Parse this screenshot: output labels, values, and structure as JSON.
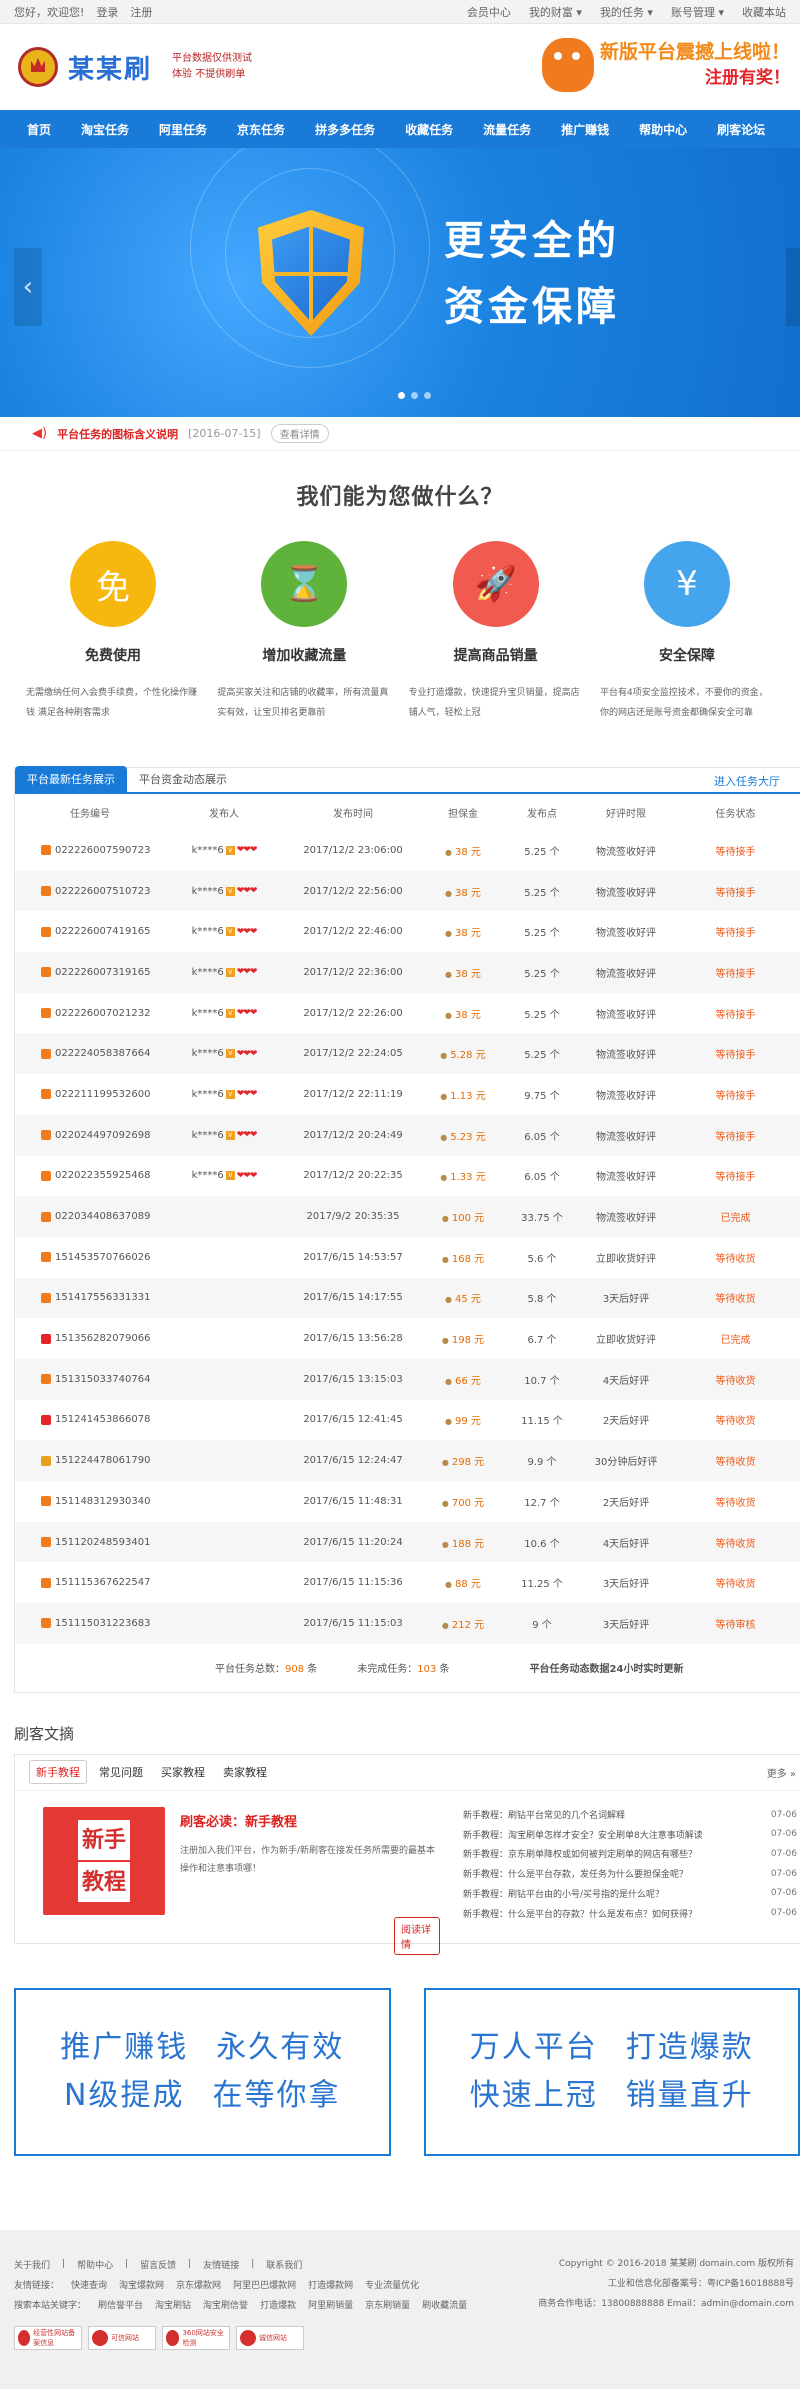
{
  "topbar": {
    "greeting": "您好，欢迎您!",
    "login": "登录",
    "register": "注册",
    "links": [
      "会员中心",
      "我的财富 ▾",
      "我的任务 ▾",
      "账号管理 ▾",
      "收藏本站"
    ]
  },
  "header": {
    "site_name": "某某刷",
    "tag_line1": "平台数据仅供测试",
    "tag_line2": "体验   不提供刷单",
    "promo_line1": "新版平台震撼上线啦！",
    "promo_line2": "注册有奖！"
  },
  "nav": [
    "首页",
    "淘宝任务",
    "阿里任务",
    "京东任务",
    "拼多多任务",
    "收藏任务",
    "流量任务",
    "推广赚钱",
    "帮助中心",
    "刷客论坛"
  ],
  "hero": {
    "line1": "更安全的",
    "line2": "资金保障",
    "prev": "‹",
    "next": "›"
  },
  "notice": {
    "text": "平台任务的图标含义说明",
    "date": "[2016-07-15]",
    "more": "查看详情"
  },
  "features": {
    "title": "我们能为您做什么？",
    "items": [
      {
        "icon": "免",
        "name": "免费使用",
        "desc": "无需缴纳任何入会费手续费，个性化操作赚钱 满足各种刷客需求",
        "color": "#f6b80e"
      },
      {
        "icon": "⌛",
        "name": "增加收藏流量",
        "desc": "提高买家关注和店铺的收藏率，所有流量真实有效，让宝贝排名更靠前",
        "color": "#5fb33a"
      },
      {
        "icon": "🚀",
        "name": "提高商品销量",
        "desc": "专业打造爆款，快速提升宝贝销量，提高店铺人气，轻松上冠",
        "color": "#f05a4f"
      },
      {
        "icon": "¥",
        "name": "安全保障",
        "desc": "平台有4项安全监控技术，不要你的资金，你的网店还是账号资金都确保安全可靠",
        "color": "#45a5ec"
      }
    ]
  },
  "tasks": {
    "tab_active": "平台最新任务展示",
    "tab_other": "平台资金动态展示",
    "enter": "进入任务大厅",
    "headers": [
      "任务编号",
      "发布人",
      "发布时间",
      "担保金",
      "发布点",
      "好评时限",
      "任务状态"
    ],
    "rows": [
      {
        "p": "tb",
        "id": "022226007590723",
        "pub": "k****6",
        "time": "2017/12/2 23:06:00",
        "dep": "38 元",
        "pts": "5.25 个",
        "limit": "物流签收好评",
        "status": "等待接手"
      },
      {
        "p": "tb",
        "id": "022226007510723",
        "pub": "k****6",
        "time": "2017/12/2 22:56:00",
        "dep": "38 元",
        "pts": "5.25 个",
        "limit": "物流签收好评",
        "status": "等待接手"
      },
      {
        "p": "tb",
        "id": "022226007419165",
        "pub": "k****6",
        "time": "2017/12/2 22:46:00",
        "dep": "38 元",
        "pts": "5.25 个",
        "limit": "物流签收好评",
        "status": "等待接手"
      },
      {
        "p": "tb",
        "id": "022226007319165",
        "pub": "k****6",
        "time": "2017/12/2 22:36:00",
        "dep": "38 元",
        "pts": "5.25 个",
        "limit": "物流签收好评",
        "status": "等待接手"
      },
      {
        "p": "tb",
        "id": "022226007021232",
        "pub": "k****6",
        "time": "2017/12/2 22:26:00",
        "dep": "38 元",
        "pts": "5.25 个",
        "limit": "物流签收好评",
        "status": "等待接手"
      },
      {
        "p": "tb",
        "id": "022224058387664",
        "pub": "k****6",
        "time": "2017/12/2 22:24:05",
        "dep": "5.28 元",
        "pts": "5.25 个",
        "limit": "物流签收好评",
        "status": "等待接手"
      },
      {
        "p": "tb",
        "id": "022211199532600",
        "pub": "k****6",
        "time": "2017/12/2 22:11:19",
        "dep": "1.13 元",
        "pts": "9.75 个",
        "limit": "物流签收好评",
        "status": "等待接手"
      },
      {
        "p": "tb",
        "id": "022024497092698",
        "pub": "k****6",
        "time": "2017/12/2 20:24:49",
        "dep": "5.23 元",
        "pts": "6.05 个",
        "limit": "物流签收好评",
        "status": "等待接手"
      },
      {
        "p": "tb",
        "id": "022022355925468",
        "pub": "k****6",
        "time": "2017/12/2 20:22:35",
        "dep": "1.33 元",
        "pts": "6.05 个",
        "limit": "物流签收好评",
        "status": "等待接手"
      },
      {
        "p": "tb",
        "id": "022034408637089",
        "pub": "",
        "time": "2017/9/2 20:35:35",
        "dep": "100 元",
        "pts": "33.75 个",
        "limit": "物流签收好评",
        "status": "已完成"
      },
      {
        "p": "tb",
        "id": "151453570766026",
        "pub": "",
        "time": "2017/6/15 14:53:57",
        "dep": "168 元",
        "pts": "5.6 个",
        "limit": "立即收货好评",
        "status": "等待收货"
      },
      {
        "p": "tb",
        "id": "151417556331331",
        "pub": "",
        "time": "2017/6/15 14:17:55",
        "dep": "45 元",
        "pts": "5.8 个",
        "limit": "3天后好评",
        "status": "等待收货"
      },
      {
        "p": "jd",
        "id": "151356282079066",
        "pub": "",
        "time": "2017/6/15 13:56:28",
        "dep": "198 元",
        "pts": "6.7 个",
        "limit": "立即收货好评",
        "status": "已完成"
      },
      {
        "p": "tb",
        "id": "151315033740764",
        "pub": "",
        "time": "2017/6/15 13:15:03",
        "dep": "66 元",
        "pts": "10.7 个",
        "limit": "4天后好评",
        "status": "等待收货"
      },
      {
        "p": "jd",
        "id": "151241453866078",
        "pub": "",
        "time": "2017/6/15 12:41:45",
        "dep": "99 元",
        "pts": "11.15 个",
        "limit": "2天后好评",
        "status": "等待收货"
      },
      {
        "p": "gold",
        "id": "151224478061790",
        "pub": "",
        "time": "2017/6/15 12:24:47",
        "dep": "298 元",
        "pts": "9.9 个",
        "limit": "30分钟后好评",
        "status": "等待收货"
      },
      {
        "p": "tb",
        "id": "151148312930340",
        "pub": "",
        "time": "2017/6/15 11:48:31",
        "dep": "700 元",
        "pts": "12.7 个",
        "limit": "2天后好评",
        "status": "等待收货"
      },
      {
        "p": "tb",
        "id": "151120248593401",
        "pub": "",
        "time": "2017/6/15 11:20:24",
        "dep": "188 元",
        "pts": "10.6 个",
        "limit": "4天后好评",
        "status": "等待收货"
      },
      {
        "p": "tb",
        "id": "151115367622547",
        "pub": "",
        "time": "2017/6/15 11:15:36",
        "dep": "88 元",
        "pts": "11.25 个",
        "limit": "3天后好评",
        "status": "等待收货"
      },
      {
        "p": "tb",
        "id": "151115031223683",
        "pub": "",
        "time": "2017/6/15 11:15:03",
        "dep": "212 元",
        "pts": "9 个",
        "limit": "3天后好评",
        "status": "等待审核"
      }
    ],
    "summary_total_label": "平台任务总数：",
    "summary_total": "908",
    "summary_total_unit": " 条",
    "summary_unfinished_label": "未完成任务：",
    "summary_unfinished": "103",
    "summary_unfinished_unit": " 条",
    "summary_note": "平台任务动态数据24小时实时更新"
  },
  "articles": {
    "heading": "刷客文摘",
    "tabs": [
      "新手教程",
      "常见问题",
      "买家教程",
      "卖家教程"
    ],
    "more": "更多 »",
    "feature_line1": "新手",
    "feature_line2": "教程",
    "feature_title": "刷客必读：新手教程",
    "feature_desc": "注册加入我们平台，作为新手/新刷客在接发任务所需要的最基本操作和注意事项哪！",
    "feature_btn": "阅读详情",
    "list": [
      {
        "t": "新手教程：刷钻平台常见的几个名词解释",
        "d": "07-06"
      },
      {
        "t": "新手教程：淘宝刷单怎样才安全？安全刷单8大注意事项解读",
        "d": "07-06"
      },
      {
        "t": "新手教程：京东刷单降权或如何被判定刷单的网店有哪些？",
        "d": "07-06"
      },
      {
        "t": "新手教程：什么是平台存款，发任务为什么要担保金呢？",
        "d": "07-06"
      },
      {
        "t": "新手教程：刷钻平台由的小号/买号指的是什么呢？",
        "d": "07-06"
      },
      {
        "t": "新手教程：什么是平台的存款？什么是发布点？如何获得？",
        "d": "07-06"
      }
    ]
  },
  "ads": {
    "left_row1a": "推广赚钱",
    "left_row1b": "永久有效",
    "left_row2a": "N级提成",
    "left_row2b": "在等你拿",
    "right_row1a": "万人平台",
    "right_row1b": "打造爆款",
    "right_row2a": "快速上冠",
    "right_row2b": "销量直升"
  },
  "footer": {
    "links": [
      "关于我们",
      "帮助中心",
      "留言反馈",
      "友情链接",
      "联系我们"
    ],
    "friend_label": "友情链接：",
    "friends": [
      "快速查询",
      "淘宝爆款网",
      "京东爆款网",
      "阿里巴巴爆款网",
      "打造爆款网",
      "专业流量优化"
    ],
    "keywords_label": "搜索本站关键字：",
    "keywords": [
      "刷信誉平台",
      "淘宝刷钻",
      "淘宝刷信誉",
      "打造爆款",
      "阿里刷销量",
      "京东刷销量",
      "刷收藏流量"
    ],
    "copyright": "Copyright © 2016-2018 某某刷 domain.com 版权所有",
    "icp": "工业和信息化部备案号：粤ICP备16018888号",
    "contact": "商务合作电话：13800888888   Email：admin@domain.com",
    "badges": [
      "经营性网站备案信息",
      "可信网站",
      "360网站安全检测",
      "诚信网站"
    ]
  }
}
